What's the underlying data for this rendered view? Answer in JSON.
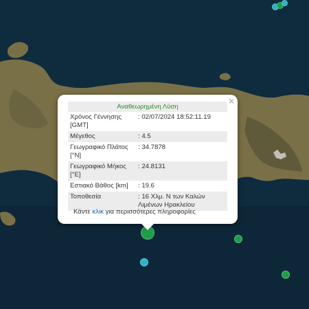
{
  "popup": {
    "title": "Αναθεωρημένη Λύση",
    "close_symbol": "×",
    "rows": [
      {
        "label": "Χρόνος Γέννησης [GMT]",
        "value": ": 02/07/2024 18:52:11.19"
      },
      {
        "label": "Μέγεθος",
        "value": ": 4.5"
      },
      {
        "label": "Γεωγραφικό Πλάτος [°N]",
        "value": ": 34.7878"
      },
      {
        "label": "Γεωγραφικό Μήκος [°E]",
        "value": ": 24.8131"
      },
      {
        "label": "Εστιακό Βάθος [km]",
        "value": ": 19.6"
      },
      {
        "label": "Τοποθεσία",
        "value": ": 16 Χλμ. Ν των Καλών Λιμένων Ηρακλείου"
      }
    ],
    "footer_prefix": "Κάντε",
    "footer_link": "κλικ",
    "footer_suffix": "για περισσότερες πληροφορίες"
  },
  "colors": {
    "sea": "#0f2c3f",
    "land": "#7a7047",
    "marker_green": "#1f9e4a",
    "marker_cyan": "#2ab3c8",
    "title_green": "#2e8b2e",
    "link_blue": "#1a5fb4"
  }
}
